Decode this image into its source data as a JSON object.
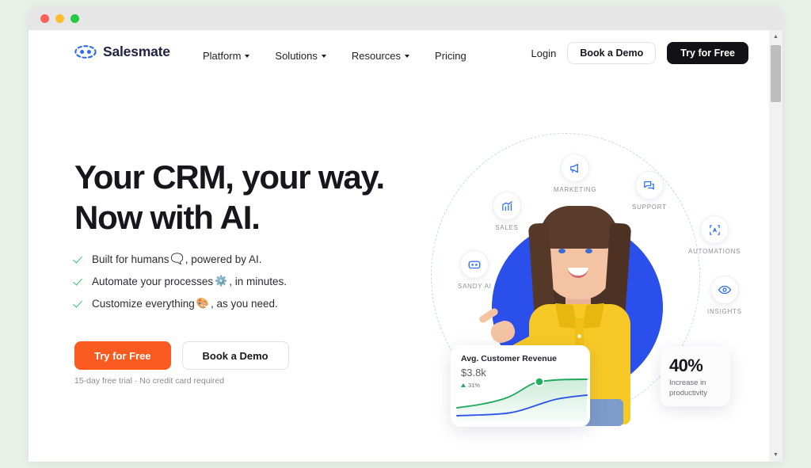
{
  "window": {
    "traffic_lights": [
      "close",
      "minimize",
      "maximize"
    ]
  },
  "header": {
    "logo_text": "Salesmate",
    "nav": [
      {
        "label": "Platform",
        "has_caret": true
      },
      {
        "label": "Solutions",
        "has_caret": true
      },
      {
        "label": "Resources",
        "has_caret": true
      },
      {
        "label": "Pricing",
        "has_caret": false
      }
    ],
    "login_label": "Login",
    "book_demo_label": "Book a Demo",
    "try_free_label": "Try for Free"
  },
  "hero": {
    "heading": "Your CRM, your way.\nNow with AI.",
    "bullets": [
      {
        "text_before": "Built for humans",
        "emoji": "🗨️",
        "text_after": ", powered by AI."
      },
      {
        "text_before": "Automate your processes",
        "emoji": "⚙️",
        "text_after": ", in minutes."
      },
      {
        "text_before": "Customize everything",
        "emoji": "🎨",
        "text_after": ", as you need."
      }
    ],
    "primary_cta": "Try for Free",
    "secondary_cta": "Book a Demo",
    "trial_note": "15-day free trial · No credit card required"
  },
  "graphic": {
    "badges": [
      {
        "id": "marketing",
        "label": "MARKETING",
        "icon": "megaphone-icon"
      },
      {
        "id": "support",
        "label": "SUPPORT",
        "icon": "chat-bubbles-icon"
      },
      {
        "id": "automations",
        "label": "AUTOMATIONS",
        "icon": "automation-loop-icon"
      },
      {
        "id": "insights",
        "label": "INSIGHTS",
        "icon": "eye-icon"
      },
      {
        "id": "sales",
        "label": "SALES",
        "icon": "bar-chart-up-icon"
      },
      {
        "id": "sandy",
        "label": "SANDY AI",
        "icon": "robot-face-icon"
      }
    ]
  },
  "chart_card": {
    "title": "Avg. Customer Revenue",
    "value": "$3.8k",
    "delta": "31%",
    "delta_direction": "up"
  },
  "stat_card": {
    "number": "40%",
    "caption": "Increase in\nproductivity"
  },
  "colors": {
    "brand_blue": "#2b4fea",
    "logo_navy": "#202342",
    "cta_orange": "#fb5a20",
    "dark_button": "#111116",
    "check_green": "#3cc36a",
    "chart_green": "#21a95c",
    "chart_blue": "#2d55e8",
    "page_bg": "#e9f2e8"
  },
  "chart_data": {
    "type": "area",
    "title": "Avg. Customer Revenue",
    "x": [
      0,
      1,
      2,
      3,
      4,
      5,
      6,
      7,
      8
    ],
    "series": [
      {
        "name": "revenue-green",
        "color": "#21a95c",
        "values": [
          22,
          24,
          26,
          30,
          40,
          54,
          62,
          66,
          68
        ]
      },
      {
        "name": "baseline-blue",
        "color": "#2d55e8",
        "values": [
          10,
          10,
          11,
          12,
          16,
          26,
          36,
          42,
          46
        ]
      }
    ],
    "marker": {
      "series": "revenue-green",
      "x": 5,
      "y": 54
    },
    "grid": false,
    "legend": "none",
    "xlabel": "",
    "ylabel": ""
  }
}
